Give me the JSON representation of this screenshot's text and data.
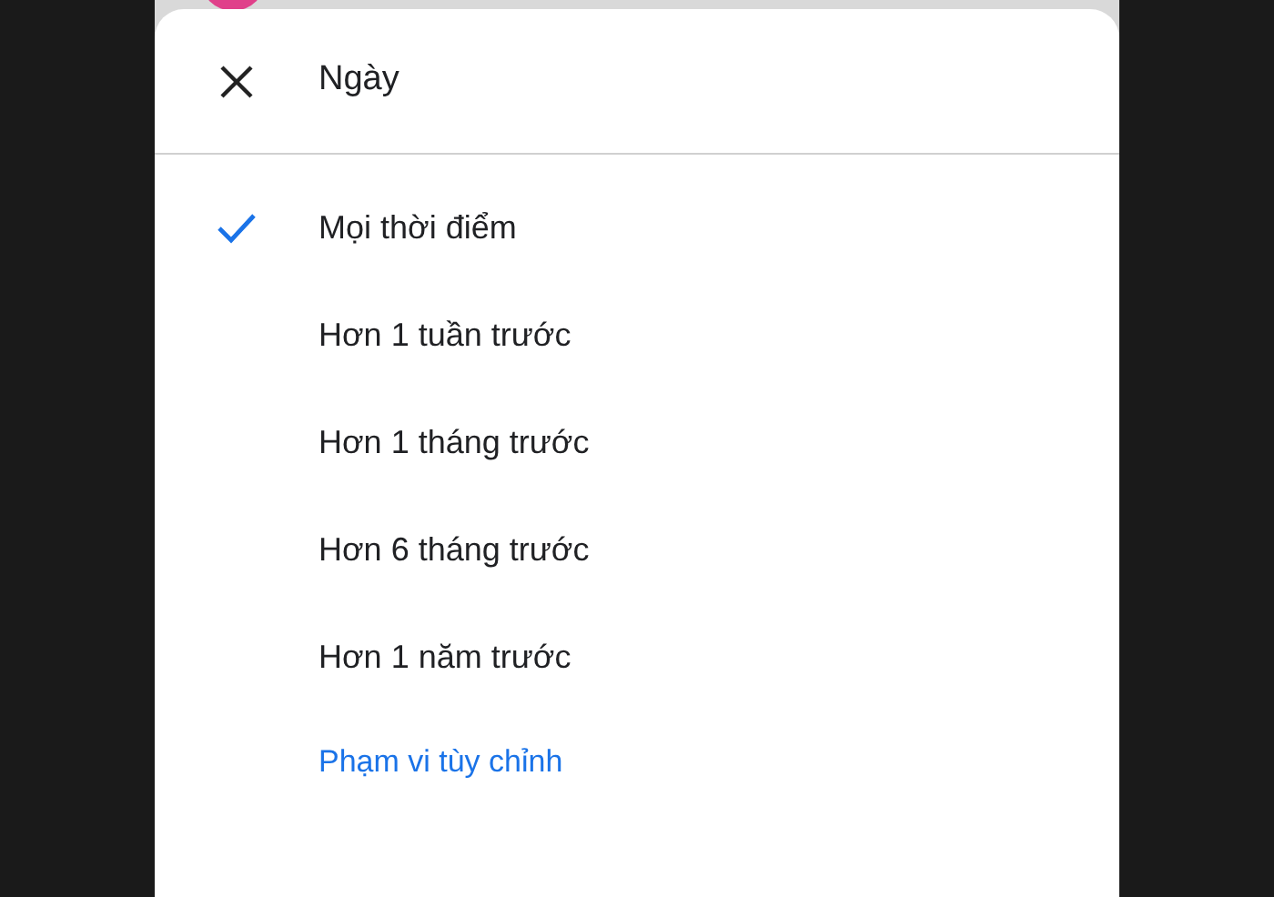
{
  "sheet": {
    "title": "Ngày",
    "options": [
      {
        "label": "Mọi thời điểm",
        "selected": true
      },
      {
        "label": "Hơn 1 tuần trước",
        "selected": false
      },
      {
        "label": "Hơn 1 tháng trước",
        "selected": false
      },
      {
        "label": "Hơn 6 tháng trước",
        "selected": false
      },
      {
        "label": "Hơn 1 năm trước",
        "selected": false
      }
    ],
    "custom_range": "Phạm vi tùy chỉnh"
  }
}
